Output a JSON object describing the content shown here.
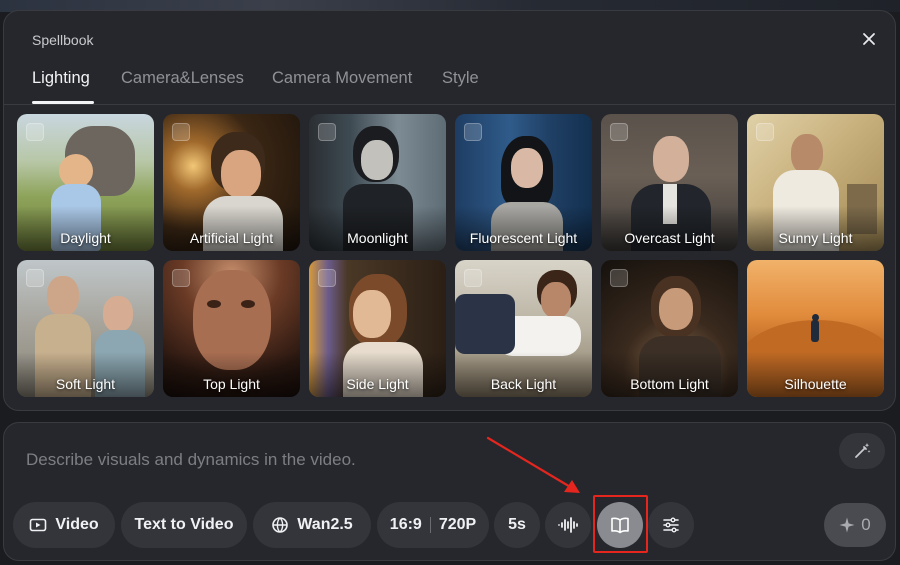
{
  "panel": {
    "title": "Spellbook",
    "tabs": [
      {
        "label": "Lighting",
        "active": true
      },
      {
        "label": "Camera&Lenses",
        "active": false
      },
      {
        "label": "Camera Movement",
        "active": false
      },
      {
        "label": "Style",
        "active": false
      }
    ],
    "presets": [
      {
        "label": "Daylight"
      },
      {
        "label": "Artificial Light"
      },
      {
        "label": "Moonlight"
      },
      {
        "label": "Fluorescent Light"
      },
      {
        "label": "Overcast Light"
      },
      {
        "label": "Sunny Light"
      },
      {
        "label": "Soft Light"
      },
      {
        "label": "Top Light"
      },
      {
        "label": "Side Light"
      },
      {
        "label": "Back Light"
      },
      {
        "label": "Bottom Light"
      },
      {
        "label": "Silhouette"
      }
    ]
  },
  "composer": {
    "placeholder": "Describe visuals and dynamics in the video.",
    "toolbar": {
      "mode_label": "Video",
      "type_label": "Text to Video",
      "model_label": "Wan2.5",
      "aspect_label": "16:9",
      "resolution_label": "720P",
      "duration_label": "5s",
      "credits_label": "0"
    }
  },
  "colors": {
    "highlight": "#e4261f",
    "accent": "#f2f3f5"
  }
}
